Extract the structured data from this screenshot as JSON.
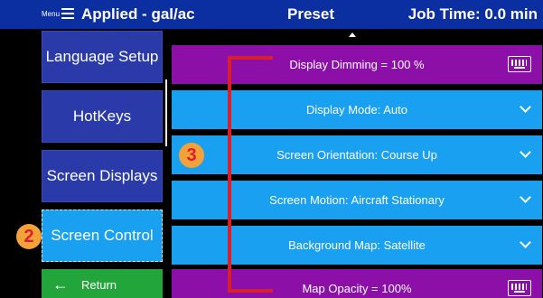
{
  "header": {
    "menu_label": "Menu",
    "title": "Applied - gal/ac",
    "preset": "Preset",
    "job_time": "Job Time: 0.0 min"
  },
  "sidebar": {
    "items": [
      {
        "label": "Language Setup"
      },
      {
        "label": "HotKeys"
      },
      {
        "label": "Screen Displays"
      },
      {
        "label": "Screen Control",
        "selected": true
      }
    ],
    "return_label": "Return"
  },
  "settings": {
    "rows": [
      {
        "label": "Display Dimming = 100 %",
        "kind": "keyboard",
        "color": "#8c10a8"
      },
      {
        "label": "Display Mode: Auto",
        "kind": "dropdown",
        "color": "#1aa0f0"
      },
      {
        "label": "Screen Orientation: Course Up",
        "kind": "dropdown",
        "color": "#1aa0f0"
      },
      {
        "label": "Screen Motion: Aircraft Stationary",
        "kind": "dropdown",
        "color": "#1aa0f0"
      },
      {
        "label": "Background Map: Satellite",
        "kind": "dropdown",
        "color": "#1aa0f0"
      },
      {
        "label": "Map Opacity = 100%",
        "kind": "keyboard",
        "color": "#8c10a8"
      }
    ]
  },
  "annotations": {
    "badge_2": "2",
    "badge_3": "3"
  },
  "colors": {
    "header_bg": "#0b2ea0",
    "sidebar_bg": "#2a3aa8",
    "selected_bg": "#1aa0f0",
    "return_bg": "#22a53a",
    "annotation_red": "#d9202a",
    "badge_orange": "#f3a23a"
  }
}
